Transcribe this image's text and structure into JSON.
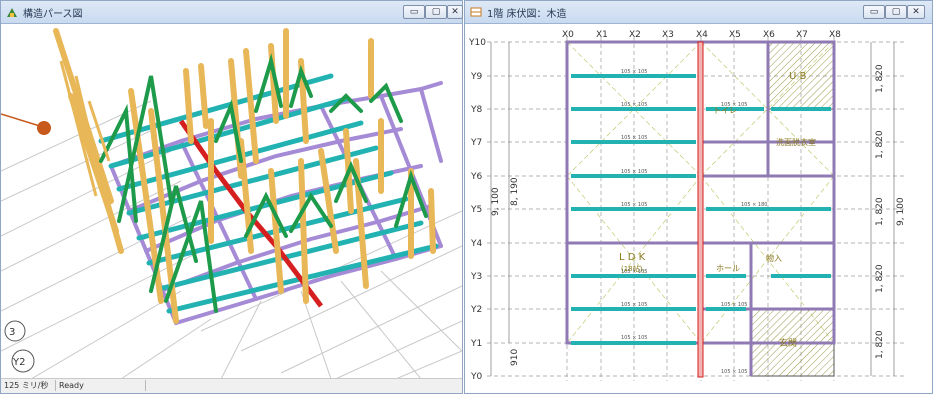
{
  "left_window": {
    "title": "構造パース図",
    "status": {
      "scale": "125 ミリ/秒",
      "state": "Ready"
    },
    "axis_markers": [
      "3",
      "Y2"
    ]
  },
  "right_window": {
    "title": "1階 床伏図：木造",
    "x_axes": [
      "X0",
      "X1",
      "X2",
      "X3",
      "X4",
      "X5",
      "X6",
      "X7",
      "X8"
    ],
    "y_axes": [
      "Y10",
      "Y9",
      "Y8",
      "Y7",
      "Y6",
      "Y5",
      "Y4",
      "Y3",
      "Y2",
      "Y1",
      "Y0"
    ],
    "right_dims": [
      "1, 820",
      "1, 820",
      "1, 820",
      "1, 820",
      "1, 820"
    ],
    "total_dim_right": "9, 100",
    "left_dims": [
      "8, 190",
      "9, 100",
      "910"
    ],
    "joist_label": "105 × 105",
    "joist_label_wide": "105 × 180",
    "rooms": {
      "ub": "U B",
      "wash": "洗面脱衣室",
      "ldk": "L D K",
      "ldk_sub": "(18帖)",
      "hall": "ホール",
      "toilet": "トイレ",
      "storage": "物入",
      "entrance": "玄関"
    }
  },
  "colors": {
    "timber": "#e8b758",
    "brace": "#1d9a4a",
    "joist": "#22b2b2",
    "sill": "#a58ad6",
    "red_beam": "#d62020",
    "callout": "#c8591c"
  }
}
